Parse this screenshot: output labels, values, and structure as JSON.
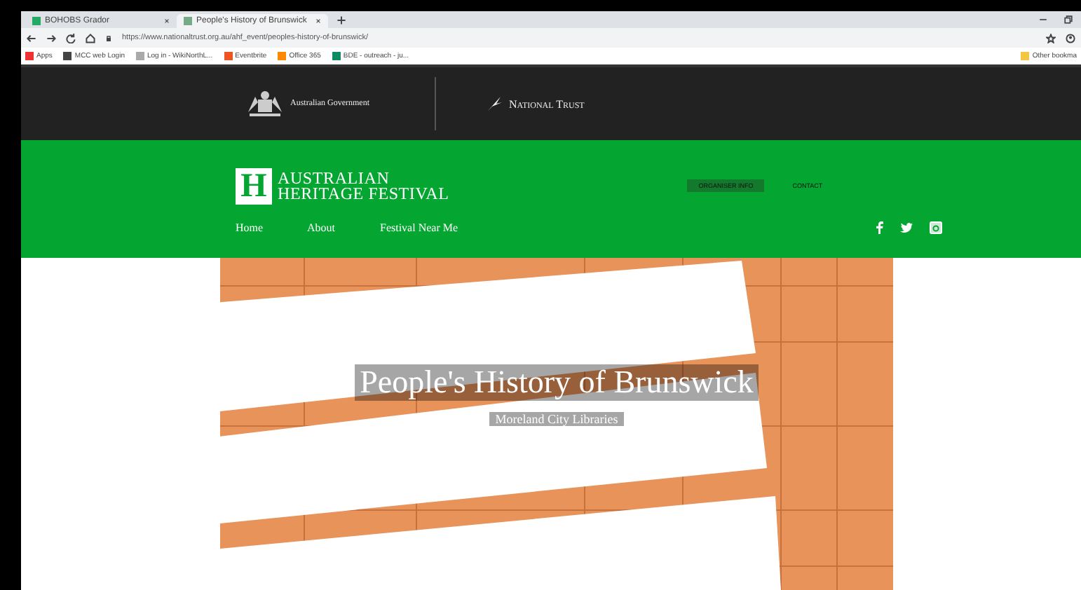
{
  "browser": {
    "tabs": [
      {
        "title": "BOHOBS Grador",
        "selected": false
      },
      {
        "title": "People's History of Brunswick",
        "selected": true
      }
    ],
    "url": "https://www.nationaltrust.org.au/ahf_event/peoples-history-of-brunswick/",
    "bookmarks": [
      "Apps",
      "MCC web Login",
      "Log in - WikiNorthL...",
      "Eventbrite",
      "Office 365",
      "BDE - outreach - ju..."
    ],
    "other_bookmarks": "Other bookma"
  },
  "top_bar": {
    "government": "Australian Government",
    "trust": "National Trust"
  },
  "festival_header": {
    "logo_letter": "H",
    "title_lines": [
      "AUSTRALIAN",
      "HERITAGE FESTIVAL"
    ],
    "nav": [
      "Home",
      "About",
      "Festival Near Me"
    ],
    "buttons": [
      {
        "label": "ORGANISER INFO",
        "selected": true
      },
      {
        "label": "CONTACT",
        "selected": false
      }
    ]
  },
  "hero": {
    "title": "People's History of Brunswick",
    "subtitle": "Moreland City Libraries"
  }
}
